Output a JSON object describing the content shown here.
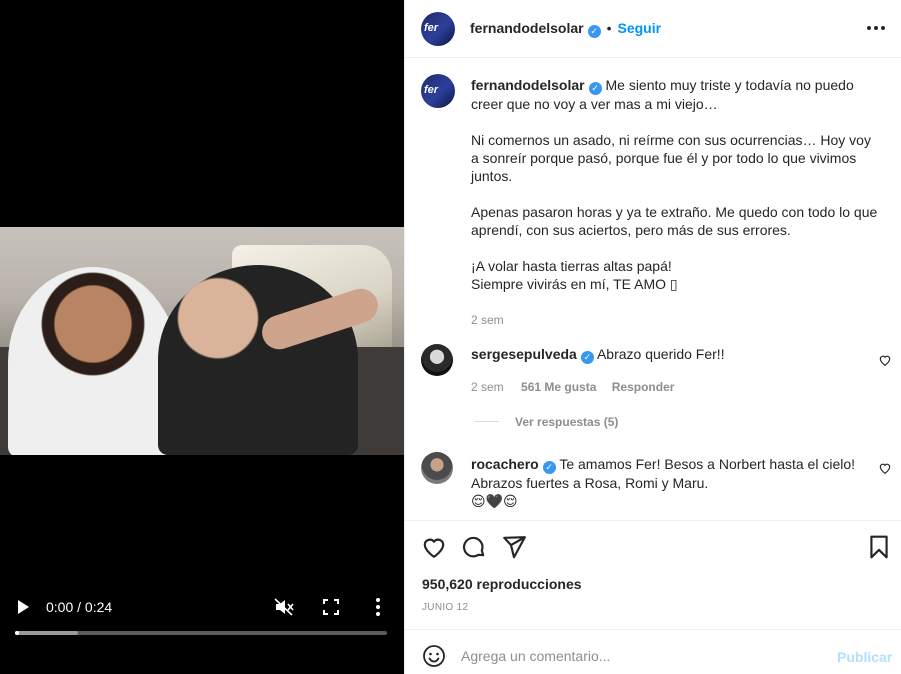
{
  "video": {
    "time": "0:00 / 0:24",
    "progress_played": 0.01,
    "progress_buffered": 0.17,
    "icons": {
      "play": "play-icon",
      "mute": "muted-speaker-icon",
      "fullscreen": "fullscreen-icon",
      "more": "more-vertical-icon"
    }
  },
  "header": {
    "username": "fernandodelsolar",
    "verified_icon": "verified-badge-icon",
    "separator": "•",
    "follow_label": "Seguir",
    "avatar_text": "fer"
  },
  "caption": {
    "username": "fernandodelsolar",
    "paragraphs": [
      "Me siento muy triste y todavía no puedo creer que no voy a ver mas a mi viejo…",
      "Ni comernos un asado, ni reírme con sus ocurrencias… Hoy voy a sonreír porque pasó, porque fue él y por todo lo que vivimos juntos.",
      "Apenas pasaron horas y ya te extraño. Me quedo con todo lo que aprendí, con sus aciertos, pero más de sus errores.",
      "¡A volar hasta tierras altas papá!",
      "Siempre vivirás en mí, TE AMO ▯"
    ],
    "age": "2 sem"
  },
  "comments": [
    {
      "username": "sergesepulveda",
      "text": "Abrazo querido Fer!!",
      "age": "2 sem",
      "likes": "561 Me gusta",
      "reply_label": "Responder",
      "view_replies": "Ver respuestas (5)"
    },
    {
      "username": "rocachero",
      "text": "Te amamos Fer! Besos a Norbert hasta el cielo! Abrazos fuertes a Rosa, Romi y Maru.",
      "emojis": "😌🖤😌"
    }
  ],
  "stats": {
    "views": "950,620 reproducciones",
    "date": "JUNIO 12"
  },
  "composer": {
    "placeholder": "Agrega un comentario...",
    "post_label": "Publicar"
  },
  "colors": {
    "accent": "#0095f6",
    "verified": "#3897f0",
    "muted_text": "#8e8e8e",
    "post_disabled": "#b2dffc"
  }
}
